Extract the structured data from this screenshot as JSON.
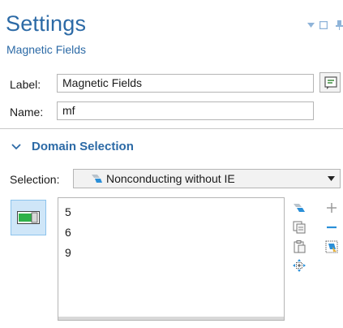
{
  "header": {
    "title": "Settings",
    "subtitle": "Magnetic Fields"
  },
  "window_controls": [
    "dropdown-arrow-icon",
    "maximize-icon",
    "pin-icon"
  ],
  "label_field": {
    "label": "Label:",
    "value": "Magnetic Fields"
  },
  "name_field": {
    "label": "Name:",
    "value": "mf"
  },
  "domain_section": {
    "title": "Domain Selection",
    "selection_label": "Selection:",
    "selection_value": "Nonconducting without IE",
    "items": [
      "5",
      "6",
      "9"
    ]
  },
  "colors": {
    "accent": "#2c6aa6",
    "toggle_bg": "#cfe6f8",
    "toggle_on": "#2fb24a"
  }
}
